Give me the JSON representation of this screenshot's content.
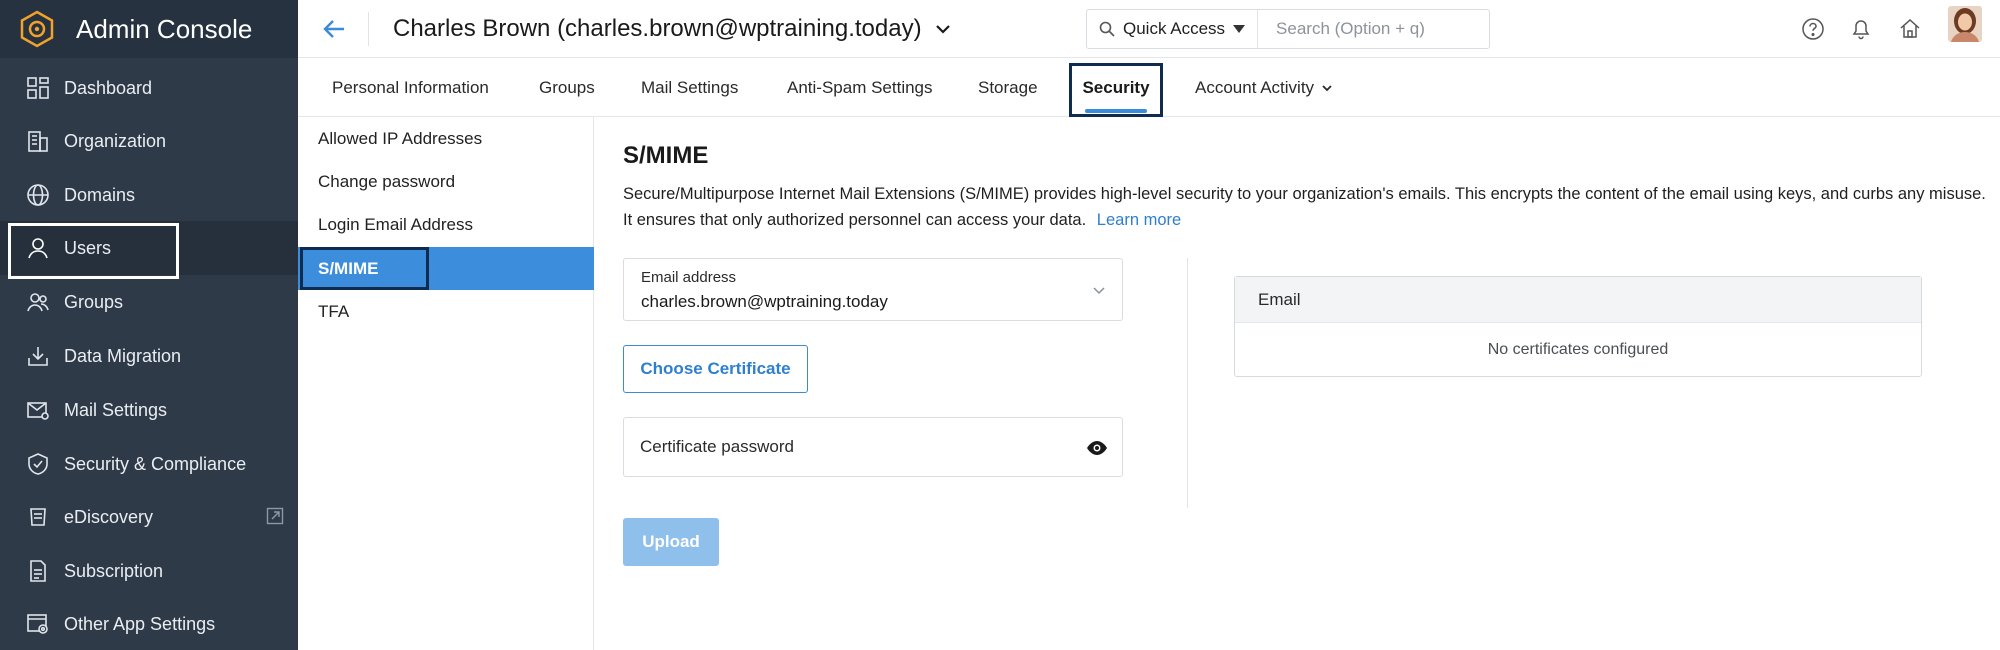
{
  "app": {
    "title": "Admin Console"
  },
  "sidebar": {
    "items": [
      {
        "label": "Dashboard",
        "icon": "dashboard-icon"
      },
      {
        "label": "Organization",
        "icon": "organization-icon"
      },
      {
        "label": "Domains",
        "icon": "globe-icon"
      },
      {
        "label": "Users",
        "icon": "user-icon",
        "active": true
      },
      {
        "label": "Groups",
        "icon": "groups-icon"
      },
      {
        "label": "Data Migration",
        "icon": "download-tray-icon"
      },
      {
        "label": "Mail Settings",
        "icon": "mail-settings-icon"
      },
      {
        "label": "Security & Compliance",
        "icon": "shield-icon"
      },
      {
        "label": "eDiscovery",
        "icon": "ediscovery-icon",
        "external": true
      },
      {
        "label": "Subscription",
        "icon": "subscription-icon"
      },
      {
        "label": "Other App Settings",
        "icon": "app-settings-icon"
      }
    ]
  },
  "header": {
    "user_title": "Charles Brown (charles.brown@wptraining.today)",
    "quick_access": "Quick Access",
    "search_placeholder": "Search (Option + q)"
  },
  "tabs": [
    {
      "label": "Personal Information"
    },
    {
      "label": "Groups"
    },
    {
      "label": "Mail Settings"
    },
    {
      "label": "Anti-Spam Settings"
    },
    {
      "label": "Storage"
    },
    {
      "label": "Security",
      "active": true
    },
    {
      "label": "Account Activity",
      "has_dropdown": true
    }
  ],
  "subnav": {
    "items": [
      {
        "label": "Allowed IP Addresses"
      },
      {
        "label": "Change password"
      },
      {
        "label": "Login Email Address"
      },
      {
        "label": "S/MIME",
        "active": true
      },
      {
        "label": "TFA"
      }
    ]
  },
  "main": {
    "heading": "S/MIME",
    "description": "Secure/Multipurpose Internet Mail Extensions (S/MIME) provides high-level security to your organization's emails. This encrypts the content of the email using keys, and curbs any misuse. It ensures that only authorized personnel can access your data.",
    "learn_more": "Learn more",
    "email_field": {
      "label": "Email address",
      "value": "charles.brown@wptraining.today"
    },
    "choose_certificate": "Choose Certificate",
    "password_placeholder": "Certificate password",
    "upload": "Upload",
    "table": {
      "header": "Email",
      "empty_text": "No certificates configured"
    }
  },
  "colors": {
    "sidebar_bg": "#2e3a48",
    "accent": "#3c8ddb",
    "active_outline": "#0e2c4f",
    "upload_disabled": "#8fbfeb"
  }
}
